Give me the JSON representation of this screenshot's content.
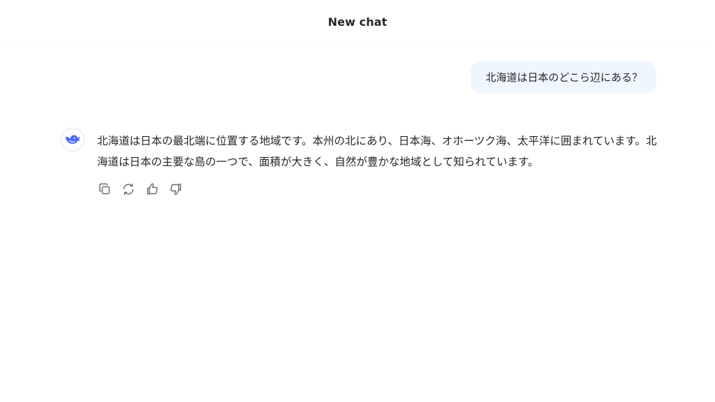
{
  "header": {
    "title": "New chat"
  },
  "conversation": {
    "user_message": "北海道は日本のどこら辺にある？",
    "assistant_message": "北海道は日本の最北端に位置する地域です。本州の北にあり、日本海、オホーツク海、太平洋に囲まれています。北海道は日本の主要な島の一つで、面積が大きく、自然が豊かな地域として知られています。"
  },
  "actions": {
    "icons": [
      "copy-icon",
      "regenerate-icon",
      "thumbs-up-icon",
      "thumbs-down-icon"
    ]
  },
  "colors": {
    "accent": "#4d6bfe",
    "user_bubble": "#eff6ff",
    "text": "#262626",
    "icon": "#6b6b6b"
  }
}
